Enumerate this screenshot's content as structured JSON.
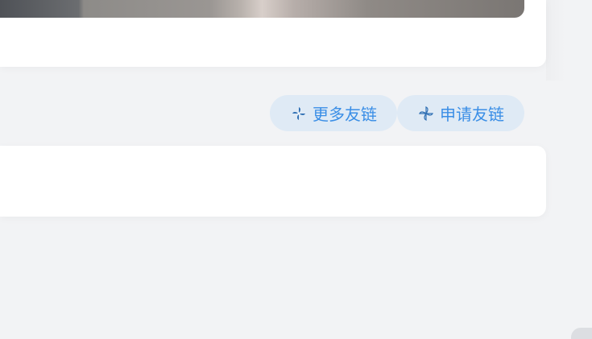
{
  "links": {
    "more_label": "更多友链",
    "apply_label": "申请友链"
  },
  "colors": {
    "accent": "#3a8ee6",
    "pill_bg": "#dfeaf5",
    "page_bg": "#f2f3f5"
  },
  "icons": {
    "more": "pinwheel-icon",
    "apply": "pinwheel-outline-icon"
  }
}
